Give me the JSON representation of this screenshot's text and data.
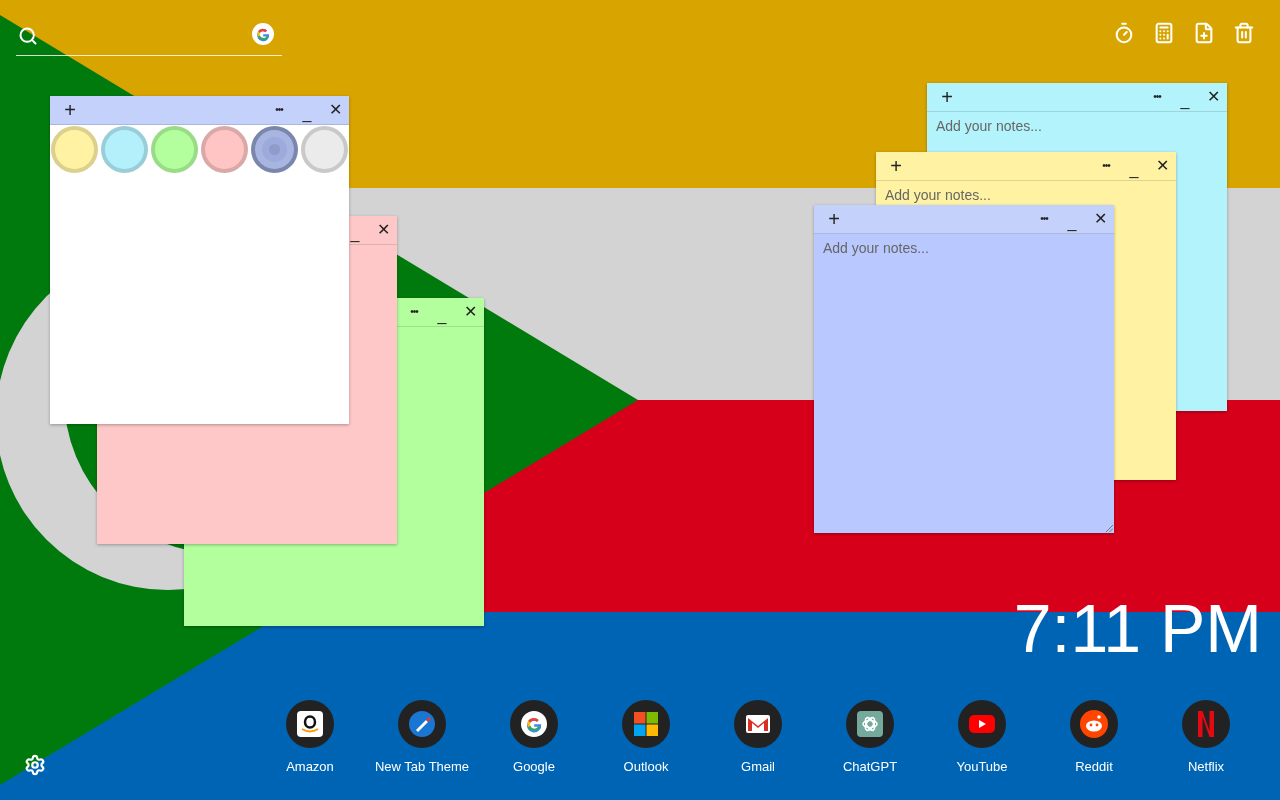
{
  "tools": [
    {
      "kind": "timer"
    },
    {
      "kind": "calculator"
    },
    {
      "kind": "add-note"
    },
    {
      "kind": "trash"
    }
  ],
  "notes": [
    {
      "color": "#b3ff9e",
      "buttons": [
        {
          "kind": "more",
          "label": "•••"
        },
        {
          "kind": "minimize",
          "label": "_"
        },
        {
          "kind": "close",
          "label": "✕"
        }
      ]
    },
    {
      "color": "#ffc8c8",
      "buttons": [
        {
          "kind": "minimize",
          "label": "_"
        },
        {
          "kind": "close",
          "label": "✕"
        }
      ]
    },
    {
      "color": "#ffffff",
      "buttons": [
        {
          "kind": "add",
          "label": "+"
        },
        {
          "kind": "more",
          "label": "•••"
        },
        {
          "kind": "minimize",
          "label": "_"
        },
        {
          "kind": "close",
          "label": "✕"
        }
      ],
      "swatches": [
        {
          "color": "#fff3a3",
          "selected": false
        },
        {
          "color": "#b3f0fc",
          "selected": false
        },
        {
          "color": "#b3ff9e",
          "selected": false
        },
        {
          "color": "#ffc4c4",
          "selected": false
        },
        {
          "color": "#8f9cc9",
          "selected": true
        },
        {
          "color": "#ebebeb",
          "selected": false
        }
      ]
    },
    {
      "color": "#b3f3fc",
      "placeholder": "Add your notes...",
      "buttons": [
        {
          "kind": "add",
          "label": "+"
        },
        {
          "kind": "more",
          "label": "•••"
        },
        {
          "kind": "minimize",
          "label": "_"
        },
        {
          "kind": "close",
          "label": "✕"
        }
      ]
    },
    {
      "color": "#fff3a3",
      "placeholder": "Add your notes...",
      "buttons": [
        {
          "kind": "add",
          "label": "+"
        },
        {
          "kind": "more",
          "label": "•••"
        },
        {
          "kind": "minimize",
          "label": "_"
        },
        {
          "kind": "close",
          "label": "✕"
        }
      ]
    },
    {
      "color": "#b9c8ff",
      "placeholder": "Add your notes...",
      "buttons": [
        {
          "kind": "add",
          "label": "+"
        },
        {
          "kind": "more",
          "label": "•••"
        },
        {
          "kind": "minimize",
          "label": "_"
        },
        {
          "kind": "close",
          "label": "✕"
        }
      ]
    }
  ],
  "clock": {
    "time": "7:11 PM"
  },
  "dock": [
    {
      "kind": "amazon",
      "label": "Amazon"
    },
    {
      "kind": "theme",
      "label": "New Tab Theme"
    },
    {
      "kind": "google",
      "label": "Google"
    },
    {
      "kind": "outlook",
      "label": "Outlook"
    },
    {
      "kind": "gmail",
      "label": "Gmail"
    },
    {
      "kind": "chatgpt",
      "label": "ChatGPT"
    },
    {
      "kind": "youtube",
      "label": "YouTube"
    },
    {
      "kind": "reddit",
      "label": "Reddit"
    },
    {
      "kind": "netflix",
      "label": "Netflix"
    }
  ]
}
